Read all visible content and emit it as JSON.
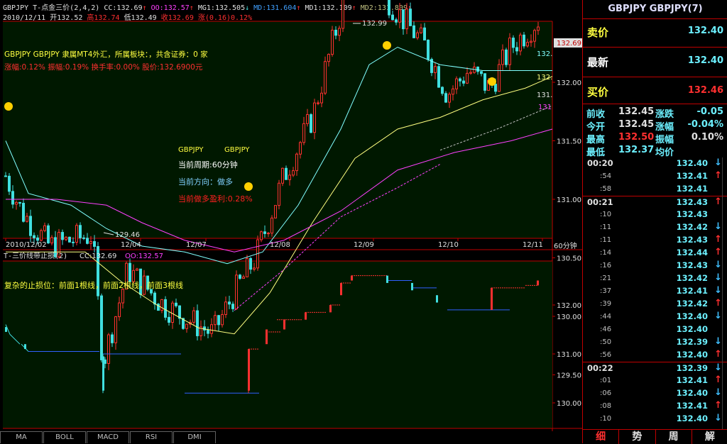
{
  "header": {
    "indicator": "GBPJPY T-点金三价(2,4,2)",
    "cc": "CC:132.69",
    "oo": "OO:132.57",
    "mg1": "MG1:132.505",
    "md": "MD:131.604",
    "md1": "MD1:132.109",
    "md2": "MD2:131.809",
    "date": "2010/12/11",
    "open": "开132.52",
    "high": "高132.74",
    "low": "低132.49",
    "close": "收132.69",
    "change": "涨(0.16)0.12%"
  },
  "info": {
    "line1": "GBPJPY GBPJPY 隶属MT4外汇，所属板块：，共含证券：0 家",
    "line2": "涨幅:0.12% 振幅:0.19% 换手率:0.00% 股价:132.6900元"
  },
  "main_chart": {
    "price_axis": [
      "132.00",
      "131.50",
      "131.00",
      "130.50",
      "130.00",
      "129.50"
    ],
    "current_price": "132.69",
    "high_label": "132.99",
    "low_label": "129.46",
    "ma_labels": [
      "132.",
      "132.",
      "131.",
      "131"
    ],
    "date_axis": [
      "2010/12/02",
      "12/04",
      "12/07",
      "12/08",
      "12/09",
      "12/10",
      "12/11"
    ],
    "period": "60分钟",
    "annotations": {
      "name1": "GBPJPY",
      "name2": "GBPJPY",
      "period_line": "当前周期:60分钟",
      "direction_line": "当前方向：做多",
      "profit_line": "当前做多盈利:0.28%"
    }
  },
  "sub_chart": {
    "title": "T-三价线带止损(2)",
    "cc": "CC:132.69",
    "oo": "OO:132.57",
    "note": "复杂的止损位：前面1根线，前面2根线，前面3根线",
    "axis": [
      "132.00",
      "131.00",
      "130.00"
    ]
  },
  "bottom_tabs": [
    "MA",
    "BOLL",
    "MACD",
    "RSI",
    "DMI"
  ],
  "right_panel": {
    "title": "GBPJPY GBPJPY(7)",
    "sell_label": "卖价",
    "sell_value": "132.40",
    "latest_label": "最新",
    "latest_value": "132.40",
    "buy_label": "买价",
    "buy_value": "132.46",
    "stats": [
      {
        "l1": "前收",
        "v1": "132.45",
        "l2": "涨跌",
        "v2": "-0.05"
      },
      {
        "l1": "今开",
        "v1": "132.45",
        "l2": "涨幅",
        "v2": "-0.04%"
      },
      {
        "l1": "最高",
        "v1": "132.50",
        "l2": "振幅",
        "v2": "0.10%"
      },
      {
        "l1": "最低",
        "v1": "132.37",
        "l2": "均价",
        "v2": ""
      }
    ],
    "ticks": [
      {
        "time": "00:20",
        "price": "132.40",
        "dir": "down"
      },
      {
        "time": ":54",
        "price": "132.41",
        "dir": "up"
      },
      {
        "time": ":58",
        "price": "132.41",
        "dir": ""
      },
      {
        "time": "00:21",
        "price": "132.43",
        "dir": "up"
      },
      {
        "time": ":10",
        "price": "132.43",
        "dir": ""
      },
      {
        "time": ":11",
        "price": "132.42",
        "dir": "down"
      },
      {
        "time": ":11",
        "price": "132.43",
        "dir": "up"
      },
      {
        "time": ":14",
        "price": "132.44",
        "dir": "up"
      },
      {
        "time": ":16",
        "price": "132.43",
        "dir": "down"
      },
      {
        "time": ":21",
        "price": "132.42",
        "dir": "down"
      },
      {
        "time": ":37",
        "price": "132.41",
        "dir": "down"
      },
      {
        "time": ":39",
        "price": "132.42",
        "dir": "up"
      },
      {
        "time": ":44",
        "price": "132.40",
        "dir": "down"
      },
      {
        "time": ":46",
        "price": "132.40",
        "dir": ""
      },
      {
        "time": ":50",
        "price": "132.39",
        "dir": "down"
      },
      {
        "time": ":56",
        "price": "132.40",
        "dir": "up"
      },
      {
        "time": "00:22",
        "price": "132.39",
        "dir": "down"
      },
      {
        "time": ":01",
        "price": "132.41",
        "dir": "up"
      },
      {
        "time": ":06",
        "price": "132.40",
        "dir": "down"
      },
      {
        "time": ":08",
        "price": "132.41",
        "dir": "up"
      },
      {
        "time": ":10",
        "price": "132.40",
        "dir": "down"
      }
    ],
    "tabs": [
      "细",
      "势",
      "周",
      "解"
    ]
  },
  "colors": {
    "up": "#ff3030",
    "down": "#40e0e0",
    "chart_bg": "#001800",
    "border": "#c00000",
    "ma_yellow": "#ffff80",
    "ma_cyan": "#80ffff",
    "ma_magenta": "#ff40ff"
  }
}
